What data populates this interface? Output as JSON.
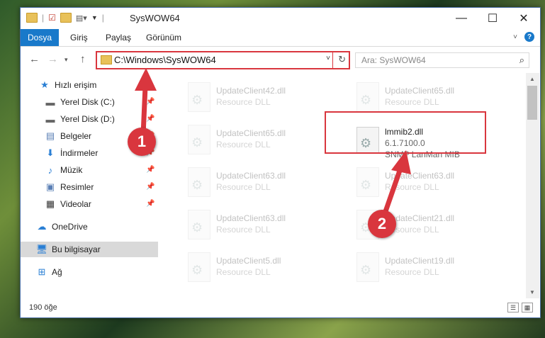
{
  "window": {
    "title": "SysWOW64",
    "controls": {
      "minimize": "—",
      "maximize": "☐",
      "close": "✕"
    }
  },
  "ribbon": {
    "tabs": [
      "Dosya",
      "Giriş",
      "Paylaş",
      "Görünüm"
    ]
  },
  "address_bar": {
    "path": "C:\\Windows\\SysWOW64"
  },
  "search": {
    "placeholder": "Ara: SysWOW64"
  },
  "sidebar": {
    "items": [
      {
        "label": "Hızlı erişim",
        "icon": "star-icon"
      },
      {
        "label": "Yerel Disk (C:)",
        "icon": "drive-icon",
        "pinned": true
      },
      {
        "label": "Yerel Disk (D:)",
        "icon": "drive-icon",
        "pinned": true
      },
      {
        "label": "Belgeler",
        "icon": "documents-icon",
        "pinned": true
      },
      {
        "label": "İndirmeler",
        "icon": "download-icon",
        "pinned": true
      },
      {
        "label": "Müzik",
        "icon": "music-icon",
        "pinned": true
      },
      {
        "label": "Resimler",
        "icon": "pictures-icon",
        "pinned": true
      },
      {
        "label": "Videolar",
        "icon": "video-icon",
        "pinned": true
      },
      {
        "label": "OneDrive",
        "icon": "cloud-icon"
      },
      {
        "label": "Bu bilgisayar",
        "icon": "computer-icon",
        "selected": true
      },
      {
        "label": "Ağ",
        "icon": "network-icon"
      }
    ]
  },
  "files": {
    "left_column": [
      {
        "name": "UpdateClient42.dll",
        "desc": "Resource DLL"
      },
      {
        "name": "UpdateClient65.dll",
        "desc": "Resource DLL"
      },
      {
        "name": "UpdateClient63.dll",
        "desc": "Resource DLL"
      },
      {
        "name": "UpdateClient63.dll",
        "desc": "Resource DLL"
      },
      {
        "name": "UpdateClient5.dll",
        "desc": "Resource DLL"
      }
    ],
    "right_column": [
      {
        "name": "UpdateClient65.dll",
        "desc": "Resource DLL"
      },
      {
        "name": "lmmib2.dll",
        "version": "6.1.7100.0",
        "desc": "SNMP LanMan MIB",
        "highlighted": true
      },
      {
        "name": "UpdateClient63.dll",
        "desc": "Resource DLL"
      },
      {
        "name": "UpdateClient21.dll",
        "desc": "Resource DLL"
      },
      {
        "name": "UpdateClient19.dll",
        "desc": "Resource DLL"
      }
    ]
  },
  "status": {
    "item_count": "190 öğe"
  },
  "markers": {
    "one": "1",
    "two": "2"
  },
  "colors": {
    "accent": "#1979ca",
    "highlight": "#d9363e"
  }
}
